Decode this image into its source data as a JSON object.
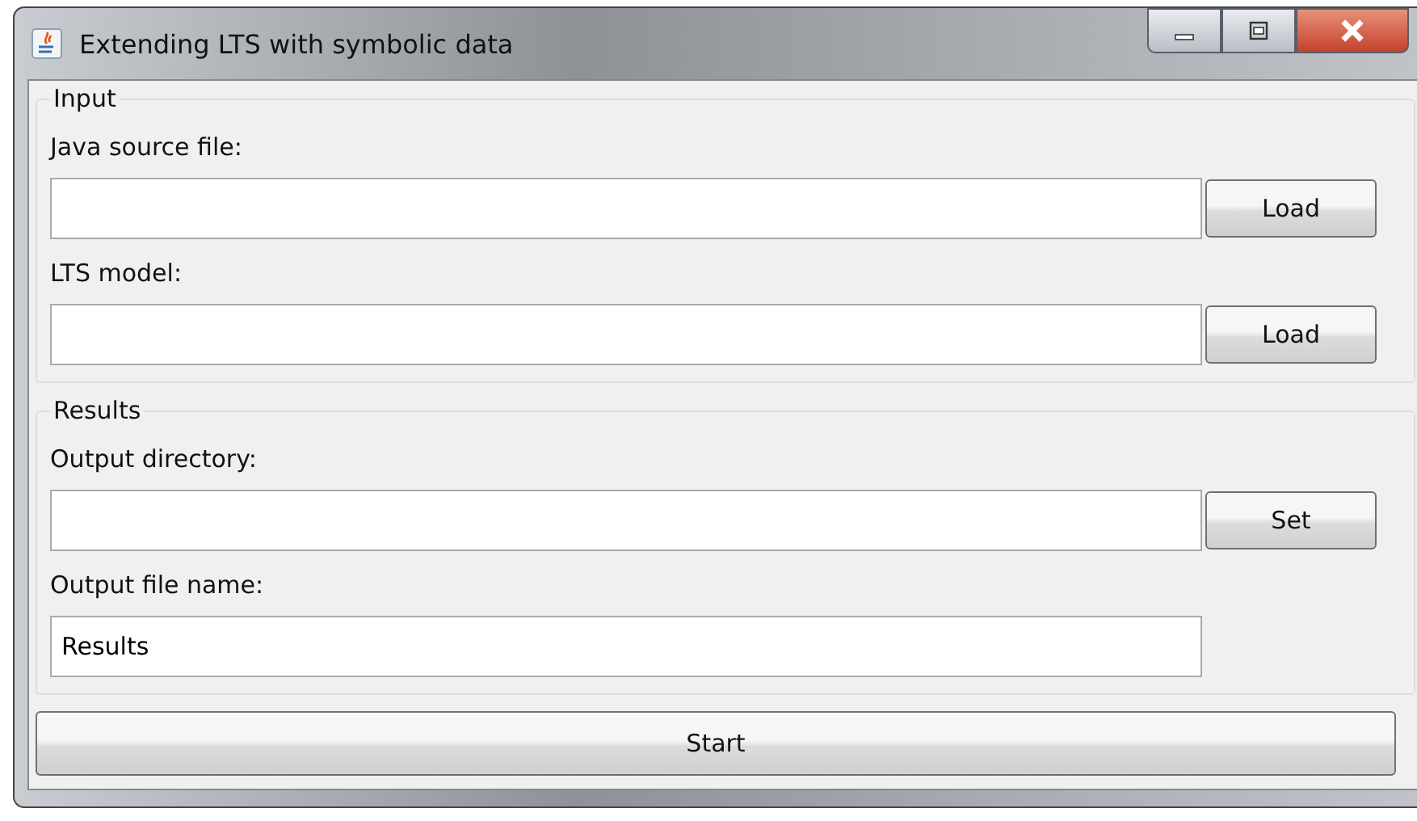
{
  "window": {
    "title": "Extending LTS with symbolic data"
  },
  "groups": [
    {
      "title": "Input",
      "rows": [
        {
          "label": "Java source file:",
          "value": "",
          "button": "Load"
        },
        {
          "label": "LTS model:",
          "value": "",
          "button": "Load"
        }
      ]
    },
    {
      "title": "Results",
      "rows": [
        {
          "label": "Output directory:",
          "value": "",
          "button": "Set"
        },
        {
          "label": "Output file name:",
          "value": "Results"
        }
      ]
    }
  ],
  "start_button": "Start"
}
